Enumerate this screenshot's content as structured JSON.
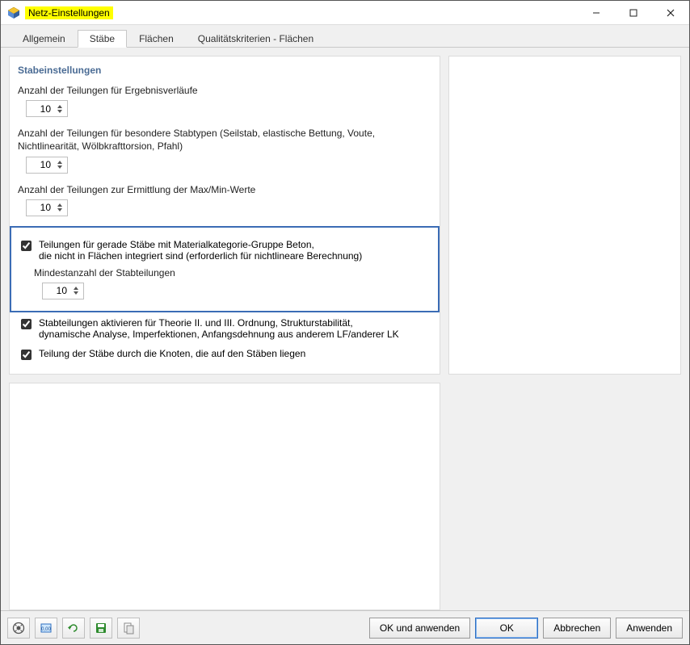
{
  "window": {
    "title": "Netz-Einstellungen"
  },
  "tabs": {
    "allgemein": "Allgemein",
    "staebe": "Stäbe",
    "flaechen": "Flächen",
    "qualitaet": "Qualitätskriterien - Flächen"
  },
  "section": {
    "title": "Stabeinstellungen",
    "field1_label": "Anzahl der Teilungen für Ergebnisverläufe",
    "field1_value": "10",
    "field2_label": "Anzahl der Teilungen für besondere Stabtypen (Seilstab, elastische Bettung, Voute, Nichtlinearität, Wölbkrafttorsion, Pfahl)",
    "field2_value": "10",
    "field3_label": "Anzahl der Teilungen zur Ermittlung der Max/Min-Werte",
    "field3_value": "10",
    "chk1_line1": "Teilungen für gerade Stäbe mit Materialkategorie-Gruppe Beton,",
    "chk1_line2": "die nicht in Flächen integriert sind (erforderlich für nichtlineare Berechnung)",
    "chk1_sub_label": "Mindestanzahl der Stabteilungen",
    "chk1_sub_value": "10",
    "chk2_line1": "Stabteilungen aktivieren für Theorie II. und III. Ordnung, Strukturstabilität,",
    "chk2_line2": "dynamische Analyse, Imperfektionen, Anfangsdehnung aus anderem LF/anderer LK",
    "chk3": "Teilung der Stäbe durch die Knoten, die auf den Stäben liegen"
  },
  "buttons": {
    "ok_apply": "OK und anwenden",
    "ok": "OK",
    "cancel": "Abbrechen",
    "apply": "Anwenden"
  }
}
